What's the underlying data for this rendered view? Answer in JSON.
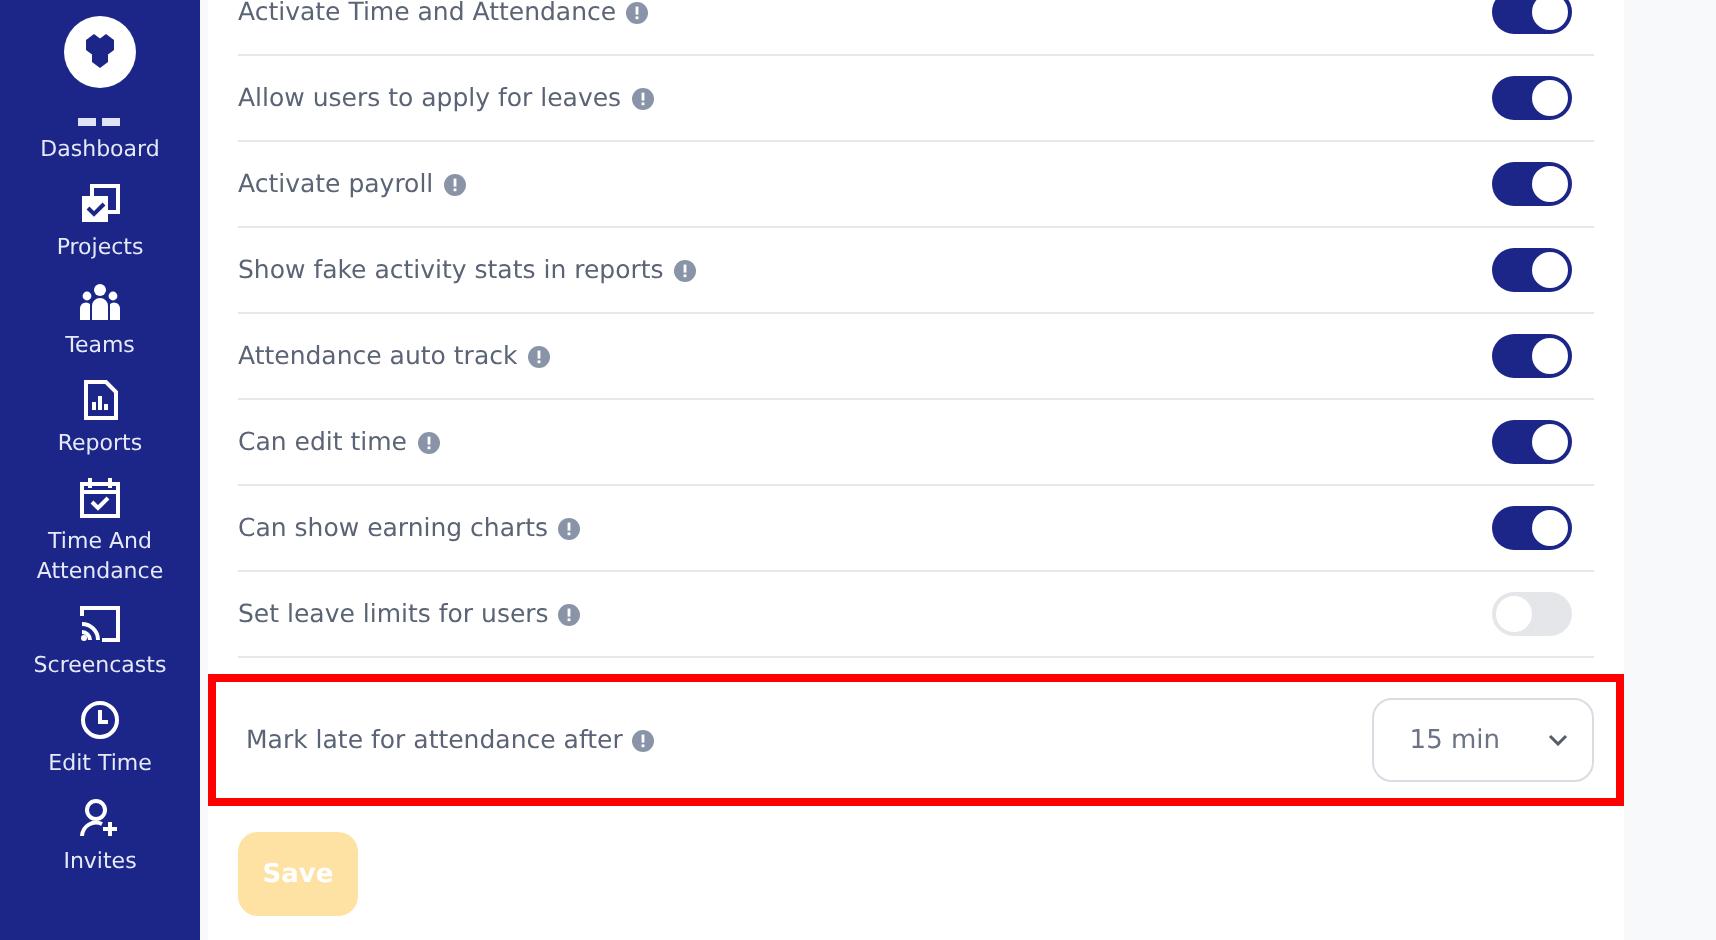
{
  "sidebar": {
    "items": [
      {
        "label": "Dashboard"
      },
      {
        "label": "Projects"
      },
      {
        "label": "Teams"
      },
      {
        "label": "Reports"
      },
      {
        "label": "Time And Attendance"
      },
      {
        "label": "Screencasts"
      },
      {
        "label": "Edit Time"
      },
      {
        "label": "Invites"
      }
    ]
  },
  "settings": [
    {
      "kind": "toggle",
      "label": "Activate Time and Attendance",
      "on": true,
      "highlighted": false
    },
    {
      "kind": "toggle",
      "label": "Allow users to apply for leaves",
      "on": true,
      "highlighted": false
    },
    {
      "kind": "toggle",
      "label": "Activate payroll",
      "on": true,
      "highlighted": false
    },
    {
      "kind": "toggle",
      "label": "Show fake activity stats in reports",
      "on": true,
      "highlighted": false
    },
    {
      "kind": "toggle",
      "label": "Attendance auto track",
      "on": true,
      "highlighted": false
    },
    {
      "kind": "toggle",
      "label": "Can edit time",
      "on": true,
      "highlighted": false
    },
    {
      "kind": "toggle",
      "label": "Can show earning charts",
      "on": true,
      "highlighted": false
    },
    {
      "kind": "toggle",
      "label": "Set leave limits for users",
      "on": false,
      "highlighted": false
    },
    {
      "kind": "select",
      "label": "Mark late for attendance after",
      "value": "15 min",
      "highlighted": true
    }
  ],
  "save_button": {
    "label": "Save",
    "disabled": true
  }
}
